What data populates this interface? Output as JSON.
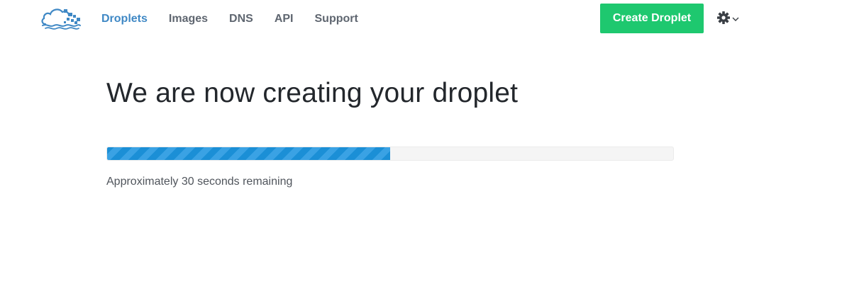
{
  "nav": {
    "logo_icon": "digitalocean-cloud-logo-icon",
    "items": [
      {
        "label": "Droplets",
        "active": true
      },
      {
        "label": "Images",
        "active": false
      },
      {
        "label": "DNS",
        "active": false
      },
      {
        "label": "API",
        "active": false
      },
      {
        "label": "Support",
        "active": false
      }
    ],
    "create_button_label": "Create Droplet",
    "settings_icon": "gear-icon",
    "settings_caret_icon": "chevron-down-icon"
  },
  "main": {
    "headline": "We are now creating your droplet",
    "progress": {
      "percent": 50,
      "status_text": "Approximately 30 seconds remaining"
    }
  },
  "colors": {
    "accent": "#3f88c5",
    "create_button": "#1ec86f",
    "progress_fill": "#1b8fd6",
    "progress_stripe": "#3aa2e4",
    "progress_track": "#f5f5f5",
    "text_dark": "#23272c",
    "nav_text": "#5f6670"
  }
}
